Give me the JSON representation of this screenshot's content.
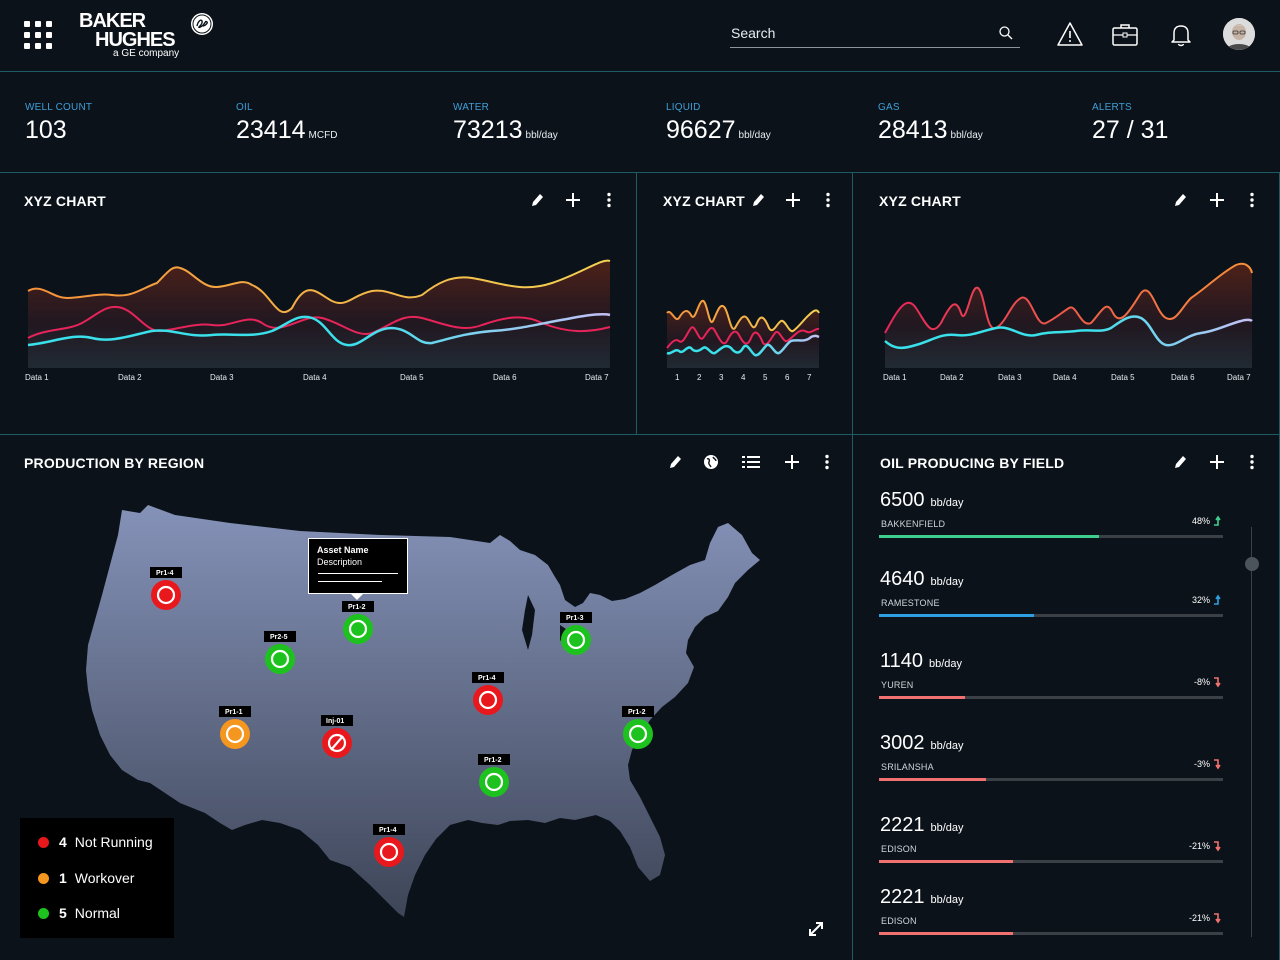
{
  "header": {
    "logo_line1": "BAKER",
    "logo_line2": "HUGHES",
    "logo_sub": "a GE company",
    "search_placeholder": "Search"
  },
  "kpis": [
    {
      "label": "WELL COUNT",
      "value": "103",
      "unit": ""
    },
    {
      "label": "OIL",
      "value": "23414",
      "unit": "MCFD"
    },
    {
      "label": "WATER",
      "value": "73213",
      "unit": "bbl/day"
    },
    {
      "label": "LIQUID",
      "value": "96627",
      "unit": "bbl/day"
    },
    {
      "label": "GAS",
      "value": "28413",
      "unit": "bbl/day"
    },
    {
      "label": "ALERTS",
      "value": "27 / 31",
      "unit": ""
    }
  ],
  "panels": {
    "chart1_title": "XYZ CHART",
    "chart2_title": "XYZ CHART",
    "chart3_title": "XYZ CHART",
    "map_title": "PRODUCTION BY REGION",
    "field_title": "OIL PRODUCING BY FIELD"
  },
  "colors": {
    "orange": "#f5913a",
    "yellow": "#f3d253",
    "pink": "#e6245a",
    "cyan": "#3ae0ea",
    "lavender": "#c5c0f5",
    "status_red": "#e8181d",
    "status_orange": "#f5961e",
    "status_green": "#1ec21e"
  },
  "chart_data": [
    {
      "type": "area",
      "categories": [
        "Data 1",
        "Data 2",
        "Data 3",
        "Data 4",
        "Data 5",
        "Data 6",
        "Data 7"
      ],
      "series": [
        {
          "color": "yellow-orange",
          "values": [
            0.62,
            0.76,
            0.62,
            0.78,
            0.59,
            0.64,
            0.7
          ]
        },
        {
          "color": "pink",
          "values": [
            0.26,
            0.36,
            0.38,
            0.22,
            0.44,
            0.3,
            0.32
          ]
        },
        {
          "color": "cyan-lavender",
          "values": [
            0.18,
            0.22,
            0.3,
            0.2,
            0.24,
            0.34,
            0.46
          ]
        }
      ]
    },
    {
      "type": "area",
      "categories": [
        "1",
        "2",
        "3",
        "4",
        "5",
        "6",
        "7"
      ],
      "series": [
        {
          "color": "yellow-orange",
          "values": [
            0.7,
            0.85,
            0.75,
            0.9,
            0.65,
            0.8,
            0.8
          ]
        },
        {
          "color": "pink",
          "values": [
            0.45,
            0.65,
            0.4,
            0.6,
            0.35,
            0.55,
            0.5
          ]
        },
        {
          "color": "cyan-lavender",
          "values": [
            0.2,
            0.35,
            0.25,
            0.3,
            0.2,
            0.35,
            0.4
          ]
        }
      ]
    },
    {
      "type": "area",
      "categories": [
        "Data 1",
        "Data 2",
        "Data 3",
        "Data 4",
        "Data 5",
        "Data 6",
        "Data 7"
      ],
      "series": [
        {
          "color": "pink-orange",
          "values": [
            0.5,
            0.8,
            0.58,
            0.78,
            0.5,
            0.84,
            0.9
          ]
        },
        {
          "color": "cyan-lavender",
          "values": [
            0.22,
            0.34,
            0.28,
            0.2,
            0.3,
            0.36,
            0.46
          ]
        }
      ]
    }
  ],
  "map": {
    "tooltip_title": "Asset Name",
    "tooltip_desc": "Description",
    "pins": [
      {
        "label": "Pr1-4",
        "status": "not-running"
      },
      {
        "label": "Pr1-2",
        "status": "normal"
      },
      {
        "label": "Pr2-5",
        "status": "normal"
      },
      {
        "label": "Pr1-3",
        "status": "normal"
      },
      {
        "label": "Pr1-4",
        "status": "not-running"
      },
      {
        "label": "Pr1-1",
        "status": "workover"
      },
      {
        "label": "Inj-01",
        "status": "not-running"
      },
      {
        "label": "Pr1-2",
        "status": "normal"
      },
      {
        "label": "Pr1-2",
        "status": "normal"
      },
      {
        "label": "Pr1-4",
        "status": "not-running"
      }
    ],
    "legend": [
      {
        "count": "4",
        "label": "Not Running",
        "color": "#e8181d"
      },
      {
        "count": "1",
        "label": "Workover",
        "color": "#f5961e"
      },
      {
        "count": "5",
        "label": "Normal",
        "color": "#1ec21e"
      }
    ]
  },
  "fields": [
    {
      "value": "6500",
      "unit": "bb/day",
      "name": "BAKKENFIELD",
      "pct": "48%",
      "fill": 0.64,
      "color": "#3ecf8e",
      "trend": "up",
      "arrow_color": "#3ecf8e"
    },
    {
      "value": "4640",
      "unit": "bb/day",
      "name": "RAMESTONE",
      "pct": "32%",
      "fill": 0.45,
      "color": "#2e9fe0",
      "trend": "up",
      "arrow_color": "#2e9fe0"
    },
    {
      "value": "1140",
      "unit": "bb/day",
      "name": "YUREN",
      "pct": "-8%",
      "fill": 0.25,
      "color": "#f0716f",
      "trend": "down",
      "arrow_color": "#f0716f"
    },
    {
      "value": "3002",
      "unit": "bb/day",
      "name": "SRILANSHA",
      "pct": "-3%",
      "fill": 0.31,
      "color": "#f0716f",
      "trend": "down",
      "arrow_color": "#f0716f"
    },
    {
      "value": "2221",
      "unit": "bb/day",
      "name": "EDISON",
      "pct": "-21%",
      "fill": 0.39,
      "color": "#f0716f",
      "trend": "down",
      "arrow_color": "#f0716f"
    },
    {
      "value": "2221",
      "unit": "bb/day",
      "name": "EDISON",
      "pct": "-21%",
      "fill": 0.39,
      "color": "#f0716f",
      "trend": "down",
      "arrow_color": "#f0716f"
    }
  ]
}
